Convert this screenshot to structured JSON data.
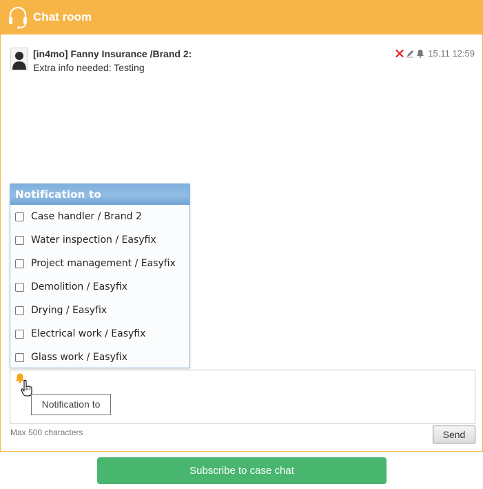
{
  "header": {
    "title": "Chat room",
    "icon": "headset-icon",
    "background": "#f7b548"
  },
  "messages": [
    {
      "author": "[in4mo] Fanny Insurance /Brand 2:",
      "text": "Extra info needed: Testing",
      "time": "15.11 12:59",
      "actions": [
        "delete-icon",
        "edit-icon",
        "bell-icon"
      ]
    }
  ],
  "notification_popup": {
    "title": "Notification to",
    "options": [
      {
        "label": "Case handler / Brand 2",
        "checked": false
      },
      {
        "label": "Water inspection / Easyfix",
        "checked": false
      },
      {
        "label": "Project management / Easyfix",
        "checked": false
      },
      {
        "label": "Demolition / Easyfix",
        "checked": false
      },
      {
        "label": "Drying / Easyfix",
        "checked": false
      },
      {
        "label": "Electrical work / Easyfix",
        "checked": false
      },
      {
        "label": "Glass work / Easyfix",
        "checked": false
      }
    ]
  },
  "compose": {
    "tooltip": "Notification to",
    "max_chars_label": "Max 500 characters",
    "send_label": "Send"
  },
  "subscribe": {
    "label": "Subscribe to case chat",
    "color": "#49b66f"
  },
  "colors": {
    "accent": "#f7b548",
    "delete": "#e02020",
    "popup_header": "#7eafdc"
  }
}
